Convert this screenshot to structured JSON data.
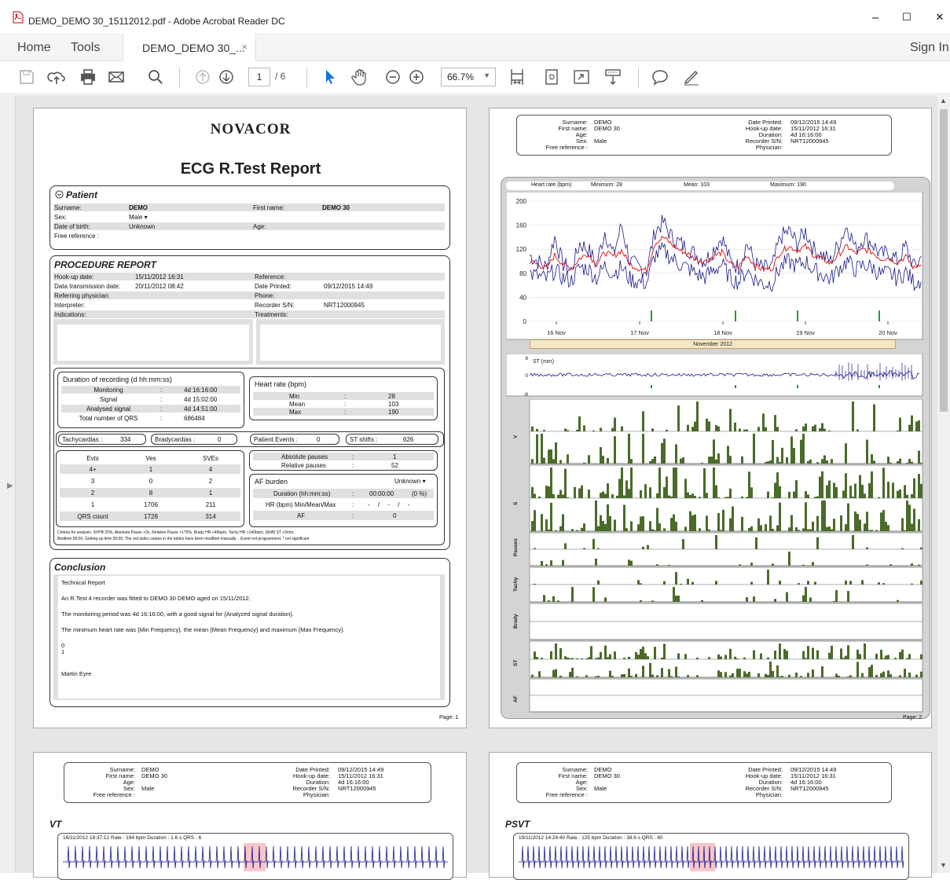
{
  "window": {
    "title": "DEMO_DEMO 30_15112012.pdf - Adobe Acrobat Reader DC",
    "minimize": "–",
    "maximize": "☐",
    "close": "✕"
  },
  "menu": {
    "home": "Home",
    "tools": "Tools",
    "tab_label": "DEMO_DEMO 30_...",
    "tab_close": "×",
    "sign_in": "Sign In"
  },
  "toolbar": {
    "page_current": "1",
    "page_total": "/ 6",
    "zoom": "66.7%"
  },
  "page1": {
    "brand": "NOVACOR",
    "title": "ECG R.Test Report",
    "patient": {
      "heading": "Patient",
      "surname_label": "Surname:",
      "surname": "DEMO",
      "firstname_label": "First name:",
      "firstname": "DEMO 30",
      "sex_label": "Sex:",
      "sex": "Male",
      "dob_label": "Date of birth:",
      "dob": "Unknown",
      "age_label": "Age:",
      "freeref_label": "Free reference :"
    },
    "procedure": {
      "heading": "PROCEDURE REPORT",
      "hookup_label": "Hook-up date:",
      "hookup": "15/11/2012 16:31",
      "reference_label": "Reference:",
      "transmission_label": "Data transmission date:",
      "transmission": "20/11/2012 08:42",
      "printed_label": "Date Printed:",
      "printed": "09/12/2015 14:49",
      "referring_label": "Referring physician:",
      "phone_label": "Phone:",
      "interpreter_label": "Interpreter:",
      "recorder_label": "Recorder S/N:",
      "recorder": "NRT12000945",
      "indications_label": "Indications:",
      "treatments_label": "Treatments:"
    },
    "duration": {
      "heading": "Duration of recording (d hh:mm:ss)",
      "rows": [
        {
          "label": "Monitoring",
          "value": "4d 16:16:00"
        },
        {
          "label": "Signal",
          "value": "4d 15:02:00"
        },
        {
          "label": "Analysed signal",
          "value": "4d 14:51:00"
        },
        {
          "label": "Total number of QRS",
          "value": "686484"
        }
      ]
    },
    "heartrate": {
      "heading": "Heart rate (bpm)",
      "rows": [
        {
          "label": "Min",
          "value": "28"
        },
        {
          "label": "Mean",
          "value": "103"
        },
        {
          "label": "Max",
          "value": "190"
        }
      ]
    },
    "events": {
      "tachy_label": "Tachycardias :",
      "tachy": "334",
      "brady_label": "Bradycardias :",
      "brady": "0",
      "patient_label": "Patient Events :",
      "patient": "0",
      "st_label": "ST shifts :",
      "st": "626"
    },
    "ves_table": {
      "headers": [
        "Evts",
        "Ves",
        "SVEs"
      ],
      "rows": [
        [
          "4+",
          "1",
          "4"
        ],
        [
          "3",
          "0",
          "2"
        ],
        [
          "2",
          "8",
          "1"
        ],
        [
          "1",
          "1706",
          "211"
        ],
        [
          "QRS count",
          "1728",
          "314"
        ]
      ]
    },
    "pauses": {
      "abs_label": "Absolute pauses",
      "abs": "1",
      "rel_label": "Relative pauses",
      "rel": "52"
    },
    "af": {
      "heading": "AF burden",
      "status": "Unknown",
      "duration_label": "Duration (hh:mm:ss)",
      "duration": "00:00:00",
      "duration_pct": "(0 %)",
      "hr_label": "HR (bpm) Min/Mean/Max",
      "hr": "- / - / -",
      "af_label": "AF",
      "af": "0"
    },
    "criteria": "Criteria for analysis: SVPB 25%, Absolute Pause >2s, Relative Pause >175%, Brady HR <40bpm, Tachy HR >140bpm, |Shift| ST >2mm,",
    "criteria2": "Bedtime 00:00, Getting-up time 00:00, The red italics values in the tables have been modified manually. - Event not programmed. * not significant",
    "conclusion": {
      "heading": "Conclusion",
      "lines": [
        "Technical Report",
        "An R.Test 4 recorder was fitted to DEMO 30 DEMO aged  on 15/11/2012.",
        "The monitoring period was 4d 16:16:00, with a good signal for {Analyzed signal duration}.",
        "The minimum heart rate was {Min Frequency}, the mean {Mean Frequency} and maximum {Max Frequency}.",
        "0",
        "1",
        "Martin Eyre"
      ]
    },
    "footer": "Page: 1"
  },
  "header_block": {
    "surname_label": "Surname:",
    "surname": "DEMO",
    "firstname_label": "First name:",
    "firstname": "DEMO 30",
    "age_label": "Age:",
    "sex_label": "Sex:",
    "sex": "Male",
    "freeref_label": "Free reference :",
    "printed_label": "Date Printed:",
    "printed": "09/12/2015 14:49",
    "hookup_label": "Hook-up date:",
    "hookup": "15/11/2012 16:31",
    "duration_label": "Duration:",
    "duration": "4d 16:16:00",
    "recorder_label": "Recorder S/N:",
    "recorder": "NRT12000945",
    "physician_label": "Physician:"
  },
  "page2": {
    "hr_header": {
      "label": "Heart rate (bpm)",
      "min": "Minimum: 28",
      "mean": "Mean: 103",
      "max": "Maximum: 190"
    },
    "month": "November 2012",
    "st_label": "ST (mm)",
    "row_labels": [
      "V",
      "S",
      "Pauses",
      "Tachy",
      "Brady",
      "ST",
      "AF"
    ],
    "footer": "Page: 2"
  },
  "page3": {
    "heading": "VT",
    "strip": "16/11/2012 18:37:12   Rate : 194 bpm   Duration : 1.6 s   QRS : 6"
  },
  "page4": {
    "heading": "PSVT",
    "strip": "19/11/2012 14:24:40   Rate : 125 bpm   Duration : 38.6 s   QRS : 80"
  },
  "chart_data": {
    "type": "line",
    "title": "Heart rate (bpm)",
    "x_ticks": [
      "16 Nov",
      "17 Nov",
      "18 Nov",
      "19 Nov",
      "20 Nov"
    ],
    "y_ticks": [
      0,
      40,
      80,
      120,
      160,
      200
    ],
    "ylim": [
      0,
      200
    ],
    "series": [
      {
        "name": "",
        "color": "#1a1a8c",
        "values": [
          110,
          100,
          90,
          140,
          95,
          85,
          130,
          120,
          95,
          150,
          110,
          160,
          100,
          90,
          85,
          150,
          165,
          140,
          130,
          120,
          110,
          100,
          120,
          140,
          100,
          90,
          130,
          95,
          88,
          90,
          140,
          150,
          130,
          150,
          120,
          110,
          100,
          130,
          160,
          120,
          140,
          130,
          110,
          115,
          100,
          125,
          90,
          110
        ]
      },
      {
        "name": "",
        "color": "#e02020",
        "values": [
          100,
          95,
          88,
          110,
          95,
          88,
          105,
          112,
          95,
          115,
          108,
          118,
          95,
          88,
          85,
          130,
          140,
          128,
          118,
          112,
          102,
          100,
          108,
          115,
          96,
          90,
          110,
          92,
          86,
          88,
          115,
          125,
          118,
          125,
          110,
          104,
          96,
          112,
          125,
          112,
          120,
          115,
          104,
          106,
          98,
          108,
          88,
          100
        ]
      },
      {
        "name": "",
        "color": "#1a1a8c",
        "values": [
          80,
          75,
          70,
          85,
          72,
          68,
          90,
          88,
          72,
          92,
          80,
          90,
          70,
          66,
          64,
          110,
          118,
          105,
          95,
          88,
          78,
          74,
          85,
          95,
          72,
          66,
          85,
          70,
          62,
          64,
          90,
          100,
          92,
          100,
          85,
          78,
          70,
          88,
          100,
          86,
          94,
          90,
          78,
          80,
          72,
          82,
          64,
          72
        ]
      }
    ]
  },
  "colors": {
    "bars": "#4a6b2a",
    "hr_blue": "#1a1a8c",
    "hr_red": "#e02020",
    "hr_green": "#1f9e2f",
    "cursor": "#1473e6"
  },
  "icons": [
    "save-icon",
    "cloud-upload-icon",
    "print-icon",
    "mail-icon",
    "search-icon",
    "page-up-icon",
    "page-down-icon",
    "select-cursor-icon",
    "hand-icon",
    "zoom-out-icon",
    "zoom-in-icon",
    "fit-page-icon",
    "rotate-icon",
    "fullscreen-icon",
    "scroll-icon",
    "comment-icon",
    "sign-pen-icon",
    "help-icon",
    "mobile-icon"
  ]
}
